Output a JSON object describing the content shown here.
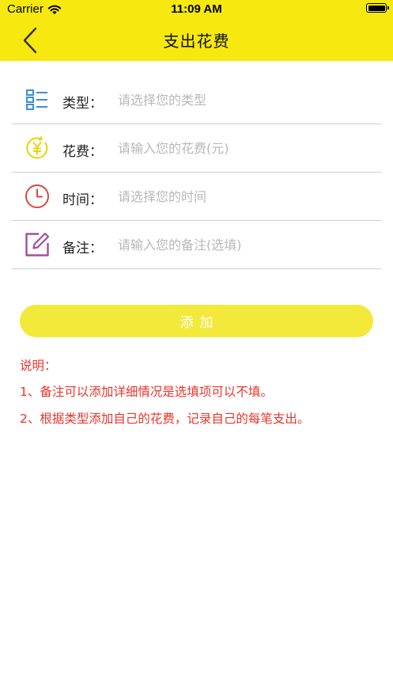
{
  "status_bar": {
    "carrier": "Carrier",
    "time": "11:09 AM"
  },
  "nav": {
    "title": "支出花费",
    "back_icon": "chevron-left-icon",
    "background": "#f7e80f"
  },
  "form": {
    "rows": [
      {
        "icon": "list-category-icon",
        "label": "类型：",
        "placeholder": "请选择您的类型",
        "value": ""
      },
      {
        "icon": "yen-coin-icon",
        "label": "花费：",
        "placeholder": "请输入您的花费(元)",
        "value": ""
      },
      {
        "icon": "clock-icon",
        "label": "时间：",
        "placeholder": "请选择您的时间",
        "value": ""
      },
      {
        "icon": "edit-note-icon",
        "label": "备注：",
        "placeholder": "请输入您的备注(选填)",
        "value": ""
      }
    ]
  },
  "actions": {
    "add_label": "添加",
    "add_button_color": "#f3e93a"
  },
  "notes": {
    "title": "说明：",
    "items": [
      "1、备注可以添加详细情况是选填项可以不填。",
      "2、根据类型添加自己的花费，记录自己的每笔支出。"
    ],
    "color": "#e8352b"
  }
}
